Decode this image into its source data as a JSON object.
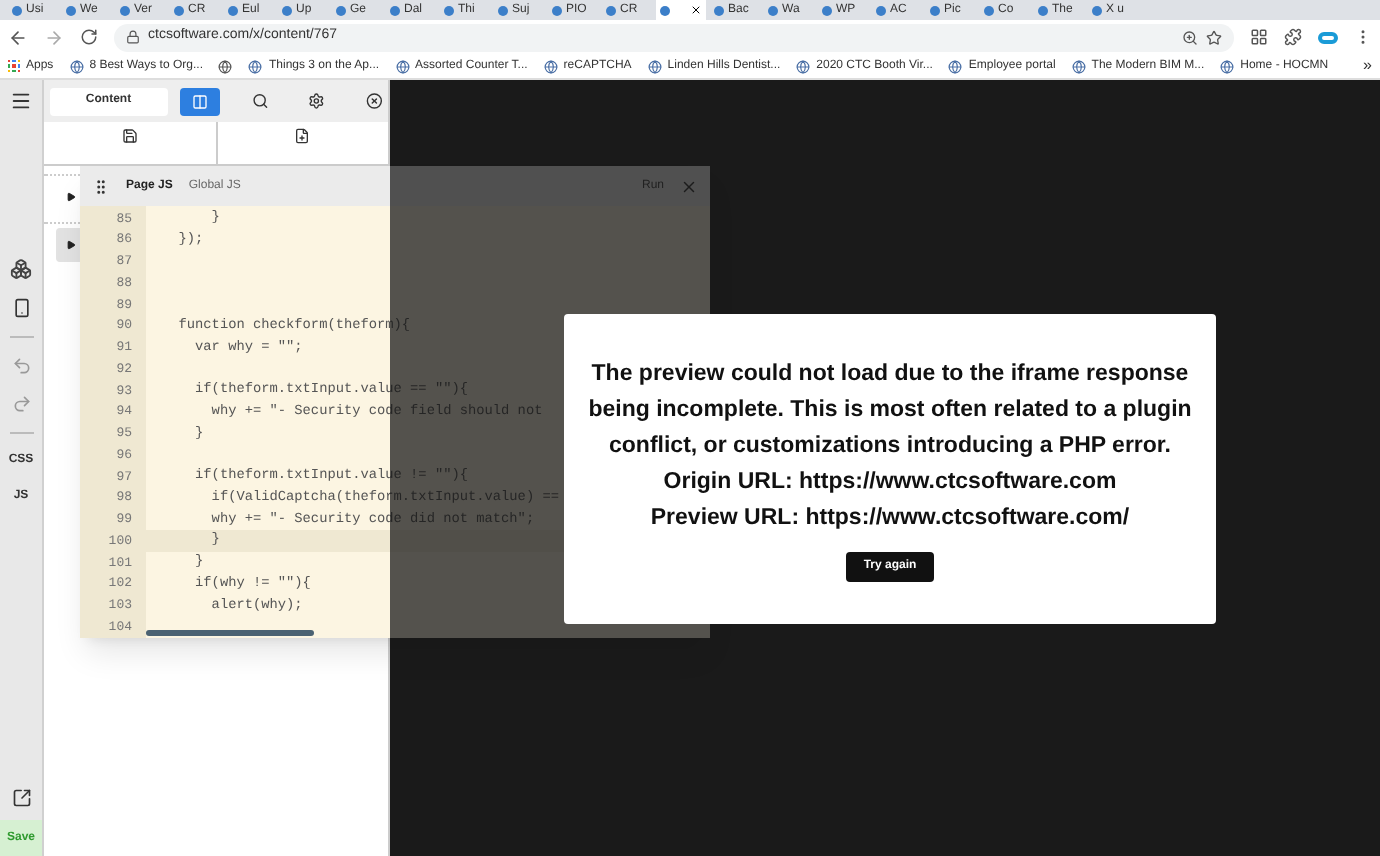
{
  "browser": {
    "tabs": [
      {
        "title": "Usi",
        "selected": false
      },
      {
        "title": "We",
        "selected": false
      },
      {
        "title": "Ver",
        "selected": false
      },
      {
        "title": "CR",
        "selected": false
      },
      {
        "title": "Eul",
        "selected": false
      },
      {
        "title": "Up",
        "selected": false
      },
      {
        "title": "Ge",
        "selected": false
      },
      {
        "title": "Dal",
        "selected": false
      },
      {
        "title": "Thi",
        "selected": false
      },
      {
        "title": "Suj",
        "selected": false
      },
      {
        "title": "PIO",
        "selected": false
      },
      {
        "title": "CR",
        "selected": false
      },
      {
        "selected": true
      },
      {
        "title": "Bac",
        "selected": false
      },
      {
        "title": "Wa",
        "selected": false
      },
      {
        "title": "WP",
        "selected": false
      },
      {
        "title": "AC",
        "selected": false
      },
      {
        "title": "Pic",
        "selected": false
      },
      {
        "title": "Co",
        "selected": false
      },
      {
        "title": "The",
        "selected": false
      },
      {
        "title": "X u",
        "selected": false
      }
    ],
    "address": "ctcsoftware.com/x/content/767",
    "bookmarks": [
      {
        "kind": "apps",
        "label": "Apps"
      },
      {
        "kind": "link",
        "label": "8 Best Ways to Org..."
      },
      {
        "kind": "icon"
      },
      {
        "kind": "link",
        "label": "Things 3 on the Ap..."
      },
      {
        "kind": "link",
        "label": "Assorted Counter T..."
      },
      {
        "kind": "link",
        "label": "reCAPTCHA"
      },
      {
        "kind": "link",
        "label": "Linden Hills Dentist..."
      },
      {
        "kind": "link",
        "label": "2020 CTC Booth Vir..."
      },
      {
        "kind": "link",
        "label": "Employee portal"
      },
      {
        "kind": "link",
        "label": "The Modern BIM M..."
      },
      {
        "kind": "link",
        "label": "Home - HOCMN"
      }
    ],
    "bookmarks_overflow": "»"
  },
  "rail": {
    "labels": [
      "CSS",
      "JS"
    ],
    "save": "Save"
  },
  "panel": {
    "content_tab": "Content",
    "layout_toggle_selected": true,
    "tree_rows": [
      {
        "selected": false
      },
      {
        "selected": true
      }
    ]
  },
  "editor": {
    "tabs": [
      {
        "label": "Page JS",
        "selected": true
      },
      {
        "label": "Global JS",
        "selected": false
      }
    ],
    "run": "Run",
    "lines": [
      {
        "number": "85",
        "code": "      }",
        "current": false
      },
      {
        "number": "86",
        "code": "  });",
        "current": false
      },
      {
        "number": "87",
        "current": false
      },
      {
        "number": "88",
        "current": false
      },
      {
        "number": "89",
        "current": false
      },
      {
        "number": "90",
        "code": "  function checkform(theform){",
        "current": false
      },
      {
        "number": "91",
        "code": "    var why = \"\";",
        "current": false
      },
      {
        "number": "92",
        "current": false
      },
      {
        "number": "93",
        "code": "    if(theform.txtInput.value == \"\"){",
        "current": false
      },
      {
        "number": "94",
        "code": "      why += \"- Security code field should not",
        "current": false
      },
      {
        "number": "95",
        "code": "    }",
        "current": false
      },
      {
        "number": "96",
        "current": false
      },
      {
        "number": "97",
        "code": "    if(theform.txtInput.value != \"\"){",
        "current": false
      },
      {
        "number": "98",
        "code": "      if(ValidCaptcha(theform.txtInput.value) ==",
        "current": false
      },
      {
        "number": "99",
        "code": "      why += \"- Security code did not match\";",
        "current": false
      },
      {
        "number": "100",
        "code": "      }",
        "current": true
      },
      {
        "number": "101",
        "code": "    }",
        "current": false
      },
      {
        "number": "102",
        "code": "    if(why != \"\"){",
        "current": false
      },
      {
        "number": "103",
        "code": "      alert(why);",
        "current": false
      },
      {
        "number": "104",
        "current": false
      }
    ]
  },
  "modal": {
    "message": "The preview could not load due to the iframe response being incomplete. This is most often related to a plugin conflict, or customizations introducing a PHP error.",
    "origin": "Origin URL: https://www.ctcsoftware.com",
    "preview": "Preview URL: https://www.ctcsoftware.com/",
    "button": "Try again"
  }
}
